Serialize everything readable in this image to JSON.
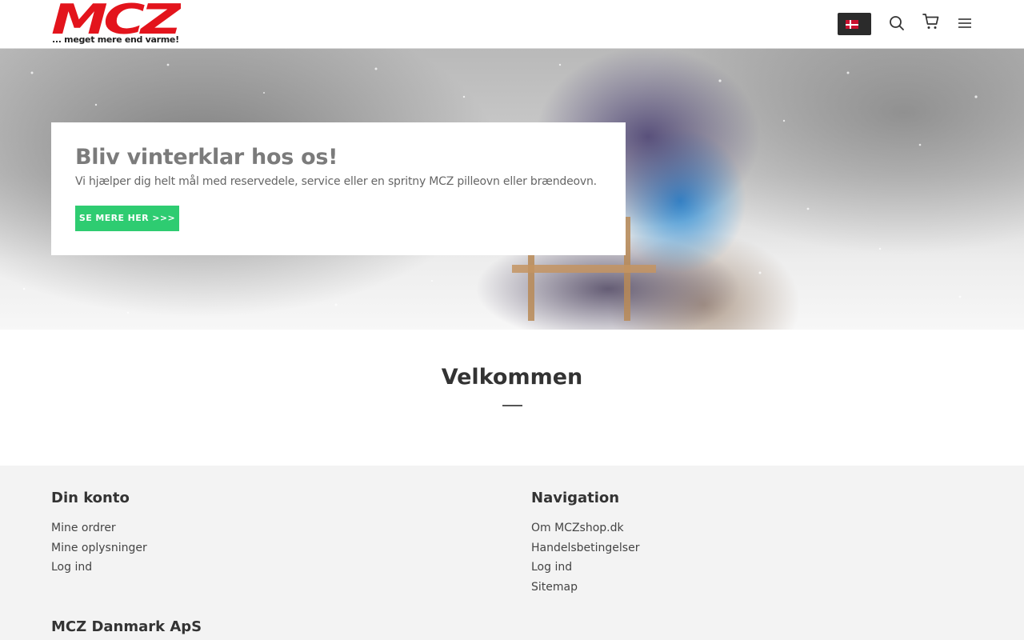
{
  "header": {
    "logo_text": "MCZ",
    "logo_tagline": "... meget mere end varme!",
    "language_flag": "danish-flag",
    "icons": [
      "search-icon",
      "cart-icon",
      "menu-icon"
    ],
    "colors": {
      "logo_red": "#e3141c",
      "header_border": "#dedede"
    }
  },
  "hero": {
    "title": "Bliv vinterklar hos os!",
    "text": "Vi hjælper dig helt mål med reservedele, service eller en spritny MCZ pilleovn eller brændeovn.",
    "button_label": "SE MERE HER >>>",
    "colors": {
      "button": "#2ecc71",
      "title": "#7b7b7b"
    }
  },
  "welcome": {
    "title": "Velkommen"
  },
  "footer": {
    "account": {
      "heading": "Din konto",
      "links": [
        "Mine ordrer",
        "Mine oplysninger",
        "Log ind"
      ]
    },
    "navigation": {
      "heading": "Navigation",
      "links": [
        "Om MCZshop.dk",
        "Handelsbetingelser",
        "Log ind",
        "Sitemap"
      ]
    },
    "company": "MCZ Danmark ApS",
    "colors": {
      "background": "#f3f3f3"
    }
  }
}
